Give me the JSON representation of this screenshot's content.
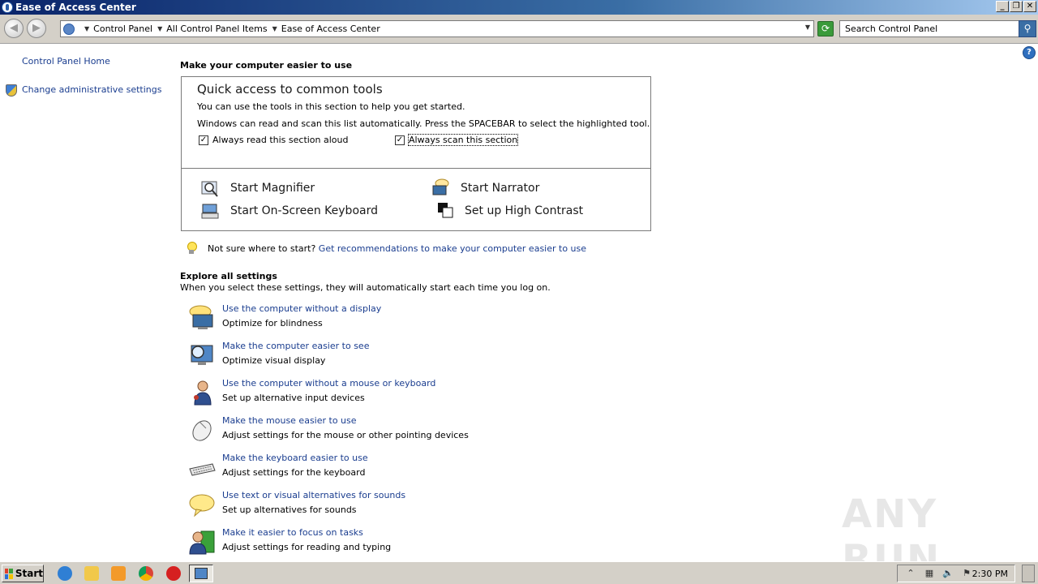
{
  "window": {
    "title": "Ease of Access Center"
  },
  "address_bar": {
    "crumbs": [
      "Control Panel",
      "All Control Panel Items",
      "Ease of Access Center"
    ]
  },
  "search": {
    "placeholder": "Search Control Panel"
  },
  "left_pane": {
    "home_link": "Control Panel Home",
    "admin_link": "Change administrative settings"
  },
  "main": {
    "heading": "Make your computer easier to use",
    "quick_access": {
      "title": "Quick access to common tools",
      "line1": "You can use the tools in this section to help you get started.",
      "line2": "Windows can read and scan this list automatically.  Press the SPACEBAR to select the highlighted tool.",
      "checkbox_read": {
        "label": "Always read this section aloud",
        "checked": true
      },
      "checkbox_scan": {
        "label": "Always scan this section",
        "checked": true
      },
      "tools": {
        "magnifier": "Start Magnifier",
        "narrator": "Start Narrator",
        "keyboard": "Start On-Screen Keyboard",
        "contrast": "Set up High Contrast"
      }
    },
    "tip": {
      "prefix": "Not sure where to start?",
      "link": "Get recommendations to make your computer easier to use"
    },
    "explore": {
      "heading": "Explore all settings",
      "subheading": "When you select these settings, they will automatically start each time you log on.",
      "items": [
        {
          "title": "Use the computer without a display",
          "desc": "Optimize for blindness",
          "icon": "monitor-speech-icon"
        },
        {
          "title": "Make the computer easier to see",
          "desc": "Optimize visual display",
          "icon": "monitor-magnify-icon"
        },
        {
          "title": "Use the computer without a mouse or keyboard",
          "desc": "Set up alternative input devices",
          "icon": "person-icon"
        },
        {
          "title": "Make the mouse easier to use",
          "desc": "Adjust settings for the mouse or other pointing devices",
          "icon": "mouse-icon"
        },
        {
          "title": "Make the keyboard easier to use",
          "desc": "Adjust settings for the keyboard",
          "icon": "keyboard-icon"
        },
        {
          "title": "Use text or visual alternatives for sounds",
          "desc": "Set up alternatives for sounds",
          "icon": "speech-bubble-icon"
        },
        {
          "title": "Make it easier to focus on tasks",
          "desc": "Adjust settings for reading and typing",
          "icon": "focus-person-icon"
        }
      ]
    }
  },
  "taskbar": {
    "start_label": "Start",
    "clock": "2:30 PM"
  },
  "watermark": "ANY RUN",
  "colors": {
    "link": "#1a3d8f",
    "titlebar": "#0a246a",
    "chrome": "#d4d0c8"
  }
}
